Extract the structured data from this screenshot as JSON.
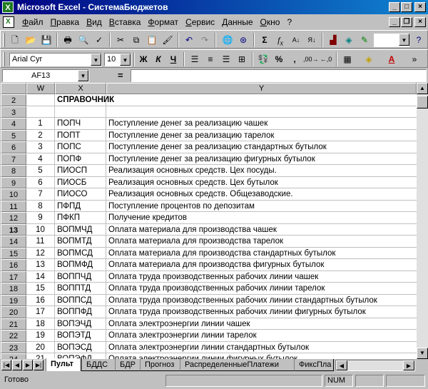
{
  "window": {
    "title": "Microsoft Excel - СистемаБюджетов",
    "app_icon": "excel-icon"
  },
  "menu": {
    "items": [
      "Файл",
      "Правка",
      "Вид",
      "Вставка",
      "Формат",
      "Сервис",
      "Данные",
      "Окно",
      "?"
    ]
  },
  "format_toolbar": {
    "font_name": "Arial Cyr",
    "font_size": "10",
    "bold_label": "Ж",
    "italic_label": "К",
    "underline_label": "Ч",
    "percent_label": "%",
    "thousands_label": ","
  },
  "formula_bar": {
    "name_box": "AF13",
    "equals": "=",
    "formula": ""
  },
  "grid": {
    "columns": [
      "W",
      "X",
      "Y"
    ],
    "active_row": "13",
    "rows": [
      {
        "r": "2",
        "w": "",
        "x": "СПРАВОЧНИК",
        "y": "",
        "bold": true
      },
      {
        "r": "3",
        "w": "",
        "x": "",
        "y": ""
      },
      {
        "r": "4",
        "w": "1",
        "x": "ПОПЧ",
        "y": "Поступление денег за реализацию чашек"
      },
      {
        "r": "5",
        "w": "2",
        "x": "ПОПТ",
        "y": "Поступление денег за реализацию тарелок"
      },
      {
        "r": "6",
        "w": "3",
        "x": "ПОПС",
        "y": "Поступление денег за реализацию стандартных бутылок"
      },
      {
        "r": "7",
        "w": "4",
        "x": "ПОПФ",
        "y": "Поступление денег за реализацию фигурных бутылок"
      },
      {
        "r": "8",
        "w": "5",
        "x": "ПИОСП",
        "y": "Реализация основных средств. Цех посуды."
      },
      {
        "r": "9",
        "w": "6",
        "x": "ПИОСБ",
        "y": "Реализация основных средств. Цех бутылок"
      },
      {
        "r": "10",
        "w": "7",
        "x": "ПИОСО",
        "y": "Реализация основных средств. Общезаводские."
      },
      {
        "r": "11",
        "w": "8",
        "x": "ПФПД",
        "y": "Поступление процентов по депозитам"
      },
      {
        "r": "12",
        "w": "9",
        "x": "ПФКП",
        "y": "Получение кредитов"
      },
      {
        "r": "13",
        "w": "10",
        "x": "ВОПМЧД",
        "y": "Оплата материала для производства чашек"
      },
      {
        "r": "14",
        "w": "11",
        "x": "ВОПМТД",
        "y": "Оплата материала для производства тарелок"
      },
      {
        "r": "15",
        "w": "12",
        "x": "ВОПМСД",
        "y": "Оплата материала для производства стандартных бутылок"
      },
      {
        "r": "16",
        "w": "13",
        "x": "ВОПМФД",
        "y": "Оплата материала для производства фигурных бутылок"
      },
      {
        "r": "17",
        "w": "14",
        "x": "ВОППЧД",
        "y": "Оплата труда производственных рабочих линии чашек"
      },
      {
        "r": "18",
        "w": "15",
        "x": "ВОППТД",
        "y": "Оплата труда производственных рабочих линии тарелок"
      },
      {
        "r": "19",
        "w": "16",
        "x": "ВОППСД",
        "y": "Оплата труда производственных рабочих линии стандартных бутылок"
      },
      {
        "r": "20",
        "w": "17",
        "x": "ВОППФД",
        "y": "Оплата труда производственных рабочих линии фигурных бутылок"
      },
      {
        "r": "21",
        "w": "18",
        "x": "ВОПЭЧД",
        "y": "Оплата электроэнергии линии чашек"
      },
      {
        "r": "22",
        "w": "19",
        "x": "ВОПЭТД",
        "y": "Оплата электроэнергии линии тарелок"
      },
      {
        "r": "23",
        "w": "20",
        "x": "ВОПЭСД",
        "y": "Оплата электроэнергии линии стандартных бутылок"
      },
      {
        "r": "24",
        "w": "21",
        "x": "ВОПЭФД",
        "y": "Оплата электроэнергии линии фигурных бутылок"
      }
    ]
  },
  "sheet_tabs": {
    "tabs": [
      "Пульт",
      "БДДС",
      "БДР",
      "Прогноз",
      "РаспределенныеПлатежи",
      "ФиксПла"
    ],
    "active": "Пульт"
  },
  "status_bar": {
    "status": "Готово",
    "num": "NUM"
  }
}
